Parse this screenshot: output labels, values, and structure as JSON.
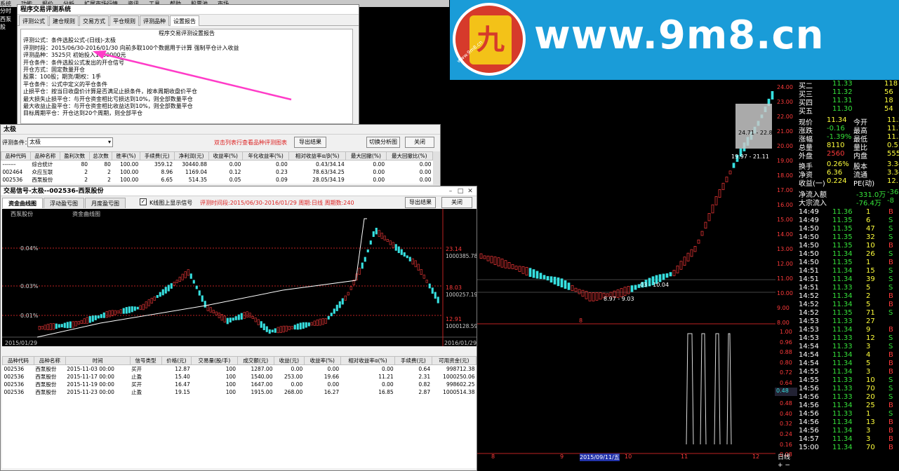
{
  "app_menu": [
    "系统",
    "功能",
    "报价",
    "分析",
    "扩展市场行情",
    "资讯",
    "工具",
    "帮助",
    "股票池",
    "市场"
  ],
  "left_strip": {
    "tab1": "分时",
    "tab2": "西泵股"
  },
  "banner": {
    "url": "www.9m8.cn",
    "small_url": "www.9m8.cn",
    "logo_char": "九"
  },
  "report_window": {
    "title": "程序交易评测系统",
    "tabs": [
      "评测公式",
      "建仓规则",
      "交易方式",
      "平仓规则",
      "评测品种",
      "设置报告"
    ],
    "active_tab": 5,
    "heading": "程序交易评测设置报告",
    "lines": [
      "评测公式：条件选股公式-(日线)-太极",
      "评测时段：2015/06/30-2016/01/30  向前多取100个数据用于计算  强制平仓计入收益",
      "评测品种：3525只  初始投入1000000元",
      "开仓条件：条件选股公式发出的开仓信号",
      "开仓方式：固定数量开仓",
      "                股票：100股；期货/期权：1手",
      "平仓条件：公式中定义的平仓条件",
      "止损平仓：按当日收盘价计算是否满足止损条件，按本周期收盘价平仓",
      "                最大损失止损平仓：与开仓资金相比亏损达到10%，则全部数量平仓",
      "                最大收益止盈平仓：与开仓资金相比收益达到10%，则全部数量平仓",
      "                目标周期平仓：开仓达到20个周期，则全部平仓",
      "                                                      "
    ]
  },
  "taiji_window": {
    "title": "太极",
    "condition_label": "评测条件：",
    "condition_value": "太极",
    "hint": "双击列表行查看品种评测图表",
    "export_btn": "导出结果",
    "switch_btn": "切换分析图",
    "close_btn": "关闭",
    "columns": [
      "品种代码",
      "品种名称",
      "盈利次数",
      "总次数",
      "胜率(%)",
      "手续费(元)",
      "净利润(元)",
      "收益率(%)",
      "年化收益率(%)",
      "相对收益率α/β(%)",
      "最大回撤(%)",
      "最大回撤比(%)"
    ],
    "rows": [
      [
        "-------",
        "综合统计",
        "80",
        "80",
        "100.00",
        "359.12",
        "30440.88",
        "0.00",
        "0.00",
        "0.43/34.14",
        "0.00",
        "0.00"
      ],
      [
        "002464",
        "众应互联",
        "2",
        "2",
        "100.00",
        "8.96",
        "1169.04",
        "0.12",
        "0.23",
        "78.63/34.25",
        "0.00",
        "0.00"
      ],
      [
        "002536",
        "西泵股份",
        "2",
        "2",
        "100.00",
        "6.65",
        "514.35",
        "0.05",
        "0.09",
        "28.05/34.19",
        "0.00",
        "0.00"
      ]
    ]
  },
  "signal_window": {
    "title": "交易信号-太极--002536-西泵股份",
    "tabs": [
      "资金曲线图",
      "浮动盈亏图",
      "月度盈亏图"
    ],
    "checkbox_label": "K线图上显示信号",
    "period_info": "评测时间段:2015/06/30-2016/01/29  周期:日线  周期数:240",
    "export_btn": "导出结果",
    "close_btn": "关闭",
    "chart_label_left": "西泵股份",
    "chart_label_curve": "资金曲线图",
    "left_axis": [
      "0.04%",
      "0.03%",
      "0.01%"
    ],
    "right_axis_price": [
      "23.14",
      "18.03",
      "12.91"
    ],
    "right_axis_money": [
      "1000385.78",
      "1000257.19",
      "1000128.59"
    ],
    "date_start": "2015/01/29",
    "date_end": "2016/01/29",
    "trade_columns": [
      "品种代码",
      "品种名称",
      "时间",
      "信号类型",
      "价格(元)",
      "交易量(股/手)",
      "成交额(元)",
      "收益(元)",
      "收益率(%)",
      "相对收益率α(%)",
      "手续费(元)",
      "可用资金(元)"
    ],
    "trades": [
      [
        "002536",
        "西泵股份",
        "2015-11-03 00:00",
        "买开",
        "12.87",
        "100",
        "1287.00",
        "0.00",
        "0.00",
        "0.00",
        "0.64",
        "998712.38"
      ],
      [
        "002536",
        "西泵股份",
        "2015-11-17 00:00",
        "止盈",
        "15.40",
        "100",
        "1540.00",
        "253.00",
        "19.66",
        "11.21",
        "2.31",
        "1000250.06"
      ],
      [
        "002536",
        "西泵股份",
        "2015-11-19 00:00",
        "买开",
        "16.47",
        "100",
        "1647.00",
        "0.00",
        "0.00",
        "0.00",
        "0.82",
        "998602.25"
      ],
      [
        "002536",
        "西泵股份",
        "2015-11-23 00:00",
        "止盈",
        "19.15",
        "100",
        "1915.00",
        "268.00",
        "16.27",
        "16.85",
        "2.87",
        "1000514.38"
      ]
    ]
  },
  "kline": {
    "price_labels": [
      "24.00",
      "23.00",
      "22.00",
      "21.00",
      "20.00",
      "19.00",
      "18.00",
      "17.00",
      "16.00",
      "15.00",
      "14.00",
      "13.00",
      "12.00",
      "11.00",
      "10.00",
      "9.00",
      "8.00"
    ],
    "annotations": {
      "a1": "03 - 10.04",
      "a2": "8.97 - 9.03",
      "a3": "24.71 - 22.88",
      "a4": "19.97 - 21.11",
      "mark": "8"
    },
    "bottom_dates": [
      "8",
      "9",
      "2015/09/11/五",
      "10",
      "11",
      "12"
    ],
    "sub_axis": [
      "1.00",
      "0.96",
      "0.88",
      "0.80",
      "0.72",
      "0.64",
      "0.56",
      "0.48",
      "0.40",
      "0.32",
      "0.24",
      "0.16",
      "0.08"
    ],
    "sub_axis_highlight": "0.48",
    "day_label": "日线"
  },
  "quote": {
    "bids": [
      {
        "label": "买二",
        "price": "11.33",
        "vol": "118"
      },
      {
        "label": "买三",
        "price": "11.32",
        "vol": "56"
      },
      {
        "label": "买四",
        "price": "11.31",
        "vol": "18"
      },
      {
        "label": "买五",
        "price": "11.30",
        "vol": "54"
      }
    ],
    "stats": [
      {
        "l1": "现价",
        "v1": "11.34",
        "l2": "今开",
        "v2": "11.5"
      },
      {
        "l1": "涨跌",
        "v1": "-0.16",
        "l2": "最高",
        "v2": "11.7"
      },
      {
        "l1": "涨幅",
        "v1": "-1.39%",
        "l2": "最低",
        "v2": "11.3"
      },
      {
        "l1": "总量",
        "v1": "8110",
        "l2": "量比",
        "v2": "0.5"
      },
      {
        "l1": "外盘",
        "v1": "2560",
        "l2": "内盘",
        "v2": "555"
      },
      {
        "l1": "换手",
        "v1": "0.26%",
        "l2": "股本",
        "v2": "3.34"
      },
      {
        "l1": "净资",
        "v1": "6.36",
        "l2": "流通",
        "v2": "3.34"
      },
      {
        "l1": "收益(一)",
        "v1": "0.224",
        "l2": "PE(动)",
        "v2": "12."
      }
    ],
    "flow": [
      {
        "label": "净流入额",
        "value": "-331.0万",
        "tail": "-36"
      },
      {
        "label": "大宗流入",
        "value": "-76.4万",
        "tail": "-8"
      }
    ],
    "ticks": [
      [
        "14:49",
        "11.36",
        "1",
        "B"
      ],
      [
        "14:49",
        "11.35",
        "6",
        "S"
      ],
      [
        "14:50",
        "11.35",
        "47",
        "S"
      ],
      [
        "14:50",
        "11.35",
        "32",
        "S"
      ],
      [
        "14:50",
        "11.35",
        "10",
        "B"
      ],
      [
        "14:50",
        "11.34",
        "26",
        "S"
      ],
      [
        "14:50",
        "11.35",
        "1",
        "B"
      ],
      [
        "14:51",
        "11.34",
        "15",
        "S"
      ],
      [
        "14:51",
        "11.34",
        "39",
        "S"
      ],
      [
        "14:51",
        "11.33",
        "5",
        "S"
      ],
      [
        "14:52",
        "11.34",
        "2",
        "B"
      ],
      [
        "14:52",
        "11.34",
        "5",
        "B"
      ],
      [
        "14:52",
        "11.35",
        "71",
        "S"
      ],
      [
        "14:53",
        "11.33",
        "27",
        ""
      ],
      [
        "14:53",
        "11.34",
        "9",
        "B"
      ],
      [
        "14:53",
        "11.33",
        "12",
        "S"
      ],
      [
        "14:54",
        "11.33",
        "3",
        "S"
      ],
      [
        "14:54",
        "11.34",
        "4",
        "B"
      ],
      [
        "14:54",
        "11.34",
        "5",
        "B"
      ],
      [
        "14:55",
        "11.34",
        "3",
        "B"
      ],
      [
        "14:55",
        "11.33",
        "10",
        "S"
      ],
      [
        "14:56",
        "11.33",
        "70",
        "S"
      ],
      [
        "14:56",
        "11.33",
        "20",
        "S"
      ],
      [
        "14:56",
        "11.34",
        "25",
        "B"
      ],
      [
        "14:56",
        "11.33",
        "1",
        "S"
      ],
      [
        "14:56",
        "11.34",
        "13",
        "B"
      ],
      [
        "14:56",
        "11.34",
        "3",
        "B"
      ],
      [
        "14:57",
        "11.34",
        "3",
        "B"
      ],
      [
        "15:00",
        "11.34",
        "70",
        "B"
      ]
    ]
  }
}
